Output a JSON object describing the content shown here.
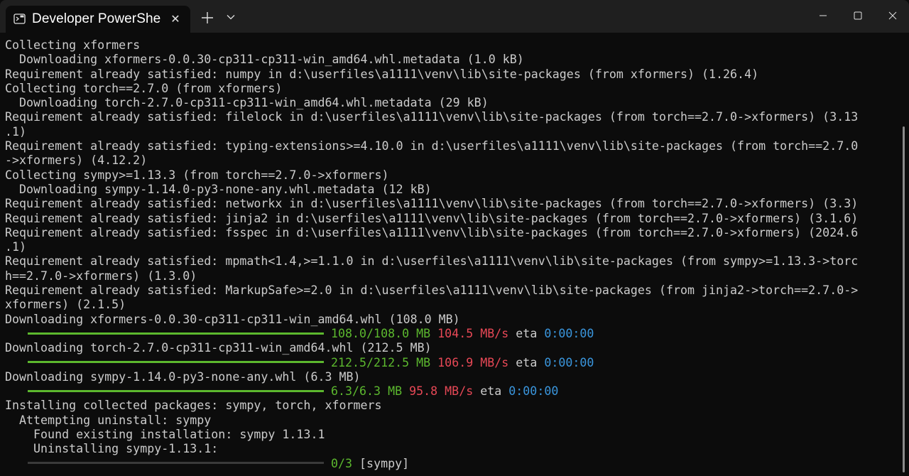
{
  "window": {
    "tab_title": "Developer PowerShe",
    "tab_icon": "terminal-icon",
    "close_tab_glyph": "✕",
    "new_tab_glyph": "+",
    "dropdown_glyph": "chevron-down-icon"
  },
  "colors": {
    "background": "#0c0c0c",
    "titlebar": "#1f1f1f",
    "text": "#cccccc",
    "progress_green": "#5cb82e",
    "speed_red": "#e74856",
    "eta_blue": "#3a96dd"
  },
  "terminal": {
    "lines": [
      "Collecting xformers",
      "  Downloading xformers-0.0.30-cp311-cp311-win_amd64.whl.metadata (1.0 kB)",
      "Requirement already satisfied: numpy in d:\\userfiles\\a1111\\venv\\lib\\site-packages (from xformers) (1.26.4)",
      "Collecting torch==2.7.0 (from xformers)",
      "  Downloading torch-2.7.0-cp311-cp311-win_amd64.whl.metadata (29 kB)",
      "Requirement already satisfied: filelock in d:\\userfiles\\a1111\\venv\\lib\\site-packages (from torch==2.7.0->xformers) (3.13",
      ".1)",
      "Requirement already satisfied: typing-extensions>=4.10.0 in d:\\userfiles\\a1111\\venv\\lib\\site-packages (from torch==2.7.0",
      "->xformers) (4.12.2)",
      "Collecting sympy>=1.13.3 (from torch==2.7.0->xformers)",
      "  Downloading sympy-1.14.0-py3-none-any.whl.metadata (12 kB)",
      "Requirement already satisfied: networkx in d:\\userfiles\\a1111\\venv\\lib\\site-packages (from torch==2.7.0->xformers) (3.3)",
      "Requirement already satisfied: jinja2 in d:\\userfiles\\a1111\\venv\\lib\\site-packages (from torch==2.7.0->xformers) (3.1.6)",
      "Requirement already satisfied: fsspec in d:\\userfiles\\a1111\\venv\\lib\\site-packages (from torch==2.7.0->xformers) (2024.6",
      ".1)",
      "Requirement already satisfied: mpmath<1.4,>=1.1.0 in d:\\userfiles\\a1111\\venv\\lib\\site-packages (from sympy>=1.13.3->torc",
      "h==2.7.0->xformers) (1.3.0)",
      "Requirement already satisfied: MarkupSafe>=2.0 in d:\\userfiles\\a1111\\venv\\lib\\site-packages (from jinja2->torch==2.7.0->",
      "xformers) (2.1.5)",
      "Downloading xformers-0.0.30-cp311-cp311-win_amd64.whl (108.0 MB)"
    ],
    "progress1": {
      "size": "108.0/108.0 MB",
      "speed": "104.5 MB/s",
      "eta_label": "eta",
      "eta": "0:00:00",
      "fraction": 1.0
    },
    "line_torch": "Downloading torch-2.7.0-cp311-cp311-win_amd64.whl (212.5 MB)",
    "progress2": {
      "size": "212.5/212.5 MB",
      "speed": "106.9 MB/s",
      "eta_label": "eta",
      "eta": "0:00:00",
      "fraction": 1.0
    },
    "line_sympy": "Downloading sympy-1.14.0-py3-none-any.whl (6.3 MB)",
    "progress3": {
      "size": "6.3/6.3 MB",
      "speed": "95.8 MB/s",
      "eta_label": "eta",
      "eta": "0:00:00",
      "fraction": 1.0
    },
    "install_lines": [
      "Installing collected packages: sympy, torch, xformers",
      "  Attempting uninstall: sympy",
      "    Found existing installation: sympy 1.13.1",
      "    Uninstalling sympy-1.13.1:"
    ],
    "progress4": {
      "count": "0/3",
      "label": "[sympy]",
      "fraction": 0.0
    }
  }
}
